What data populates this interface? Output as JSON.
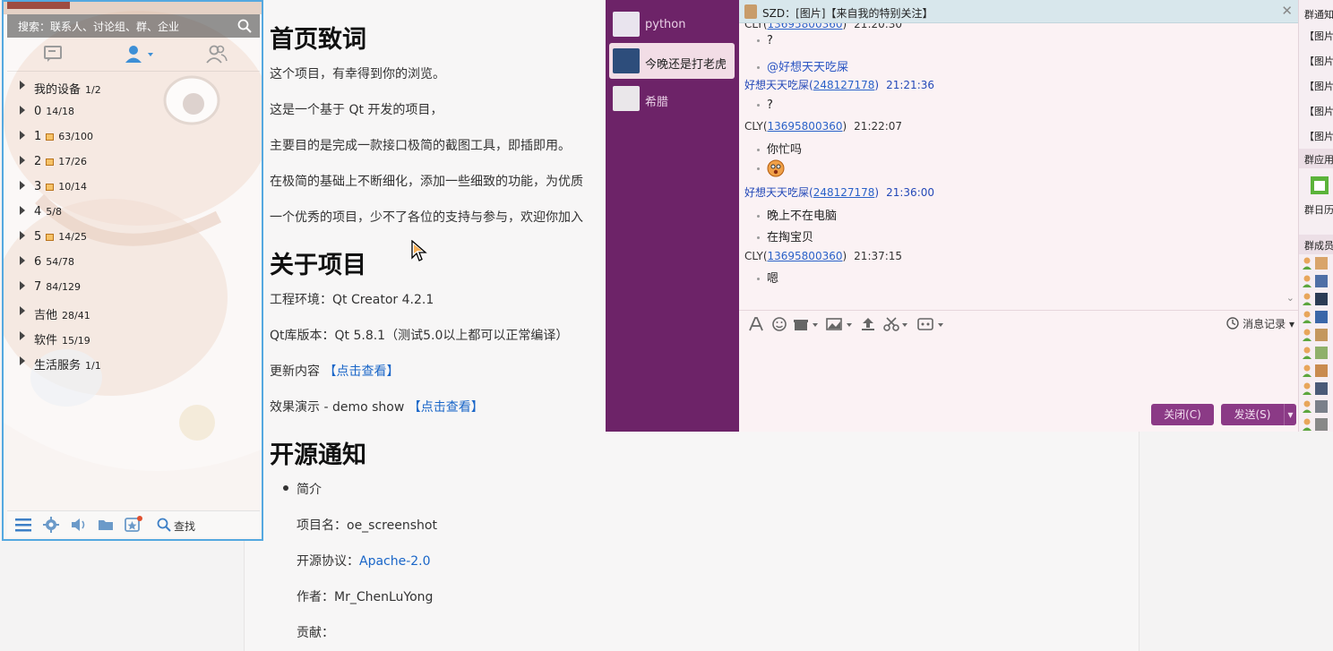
{
  "document": {
    "headings": [
      "首页致词",
      "关于项目",
      "开源通知"
    ],
    "intro": [
      "这个项目，有幸得到你的浏览。",
      "这是一个基于 Qt 开发的项目，",
      "主要目的是完成一款接口极简的截图工具，即插即用。",
      "在极简的基础上不断细化，添加一些细致的功能，为优质",
      "一个优秀的项目，少不了各位的支持与参与，欢迎你加入"
    ],
    "about": {
      "env": "工程环境：Qt Creator 4.2.1",
      "qt": "Qt库版本：Qt 5.8.1（测试5.0以上都可以正常编译）",
      "update_prefix": "更新内容 ",
      "update_link": "【点击查看】",
      "demo_prefix": "效果演示 - demo show ",
      "demo_link": "【点击查看】"
    },
    "open": {
      "bullet": "简介",
      "name": "项目名：oe_screenshot",
      "license_prefix": "开源协议：",
      "license_link": "Apache-2.0",
      "author": "作者：Mr_ChenLuYong",
      "contrib": "贡献："
    }
  },
  "qq_panel": {
    "search_placeholder": "搜索：联系人、讨论组、群、企业",
    "groups": [
      {
        "label": "我的设备",
        "count": "1/2",
        "mail": false
      },
      {
        "label": "0",
        "count": "14/18",
        "mail": false
      },
      {
        "label": "1",
        "count": "63/100",
        "mail": true
      },
      {
        "label": "2",
        "count": "17/26",
        "mail": true
      },
      {
        "label": "3",
        "count": "10/14",
        "mail": true
      },
      {
        "label": "4",
        "count": "5/8",
        "mail": false
      },
      {
        "label": "5",
        "count": "14/25",
        "mail": true
      },
      {
        "label": "6",
        "count": "54/78",
        "mail": false
      },
      {
        "label": "7",
        "count": "84/129",
        "mail": false
      },
      {
        "label": "吉他",
        "count": "28/41",
        "mail": false
      },
      {
        "label": "软件",
        "count": "15/19",
        "mail": false
      },
      {
        "label": "生活服务",
        "count": "1/1",
        "mail": false
      }
    ],
    "find_label": "查找"
  },
  "chat": {
    "conversations": [
      "python",
      "今晚还是打老虎",
      "希腊"
    ],
    "title": "SZD：[图片]【来自我的特别关注】",
    "messages": [
      {
        "type": "body",
        "text": "?"
      },
      {
        "type": "body",
        "text": "@好想天天吃屎",
        "blue": true
      },
      {
        "type": "hdr",
        "name": "好想天天吃屎",
        "uid": "248127178",
        "time": "21:21:36",
        "blue": true
      },
      {
        "type": "body",
        "text": "?"
      },
      {
        "type": "hdr",
        "name": "CLY",
        "uid": "13695800360",
        "time": "21:22:07",
        "blue": false
      },
      {
        "type": "body",
        "text": "你忙吗"
      },
      {
        "type": "emoji"
      },
      {
        "type": "hdr",
        "name": "好想天天吃屎",
        "uid": "248127178",
        "time": "21:36:00",
        "blue": true
      },
      {
        "type": "body",
        "text": "晚上不在电脑"
      },
      {
        "type": "body",
        "text": "在掏宝贝"
      },
      {
        "type": "hdr",
        "name": "CLY",
        "uid": "13695800360",
        "time": "21:37:15",
        "blue": false
      },
      {
        "type": "body",
        "text": "嗯"
      }
    ],
    "top_hdr": {
      "name": "CLY",
      "uid": "13695800360",
      "time": "21:20:30"
    },
    "history_label": "消息记录",
    "close_btn": "关闭(C)",
    "send_btn": "发送(S)",
    "right_panel": {
      "notice": "群通知",
      "image_items": [
        "【图片",
        "【图片",
        "【图片",
        "【图片",
        "【图片"
      ],
      "apps": "群应用",
      "calendar": "群日历",
      "members": "群成员"
    }
  }
}
